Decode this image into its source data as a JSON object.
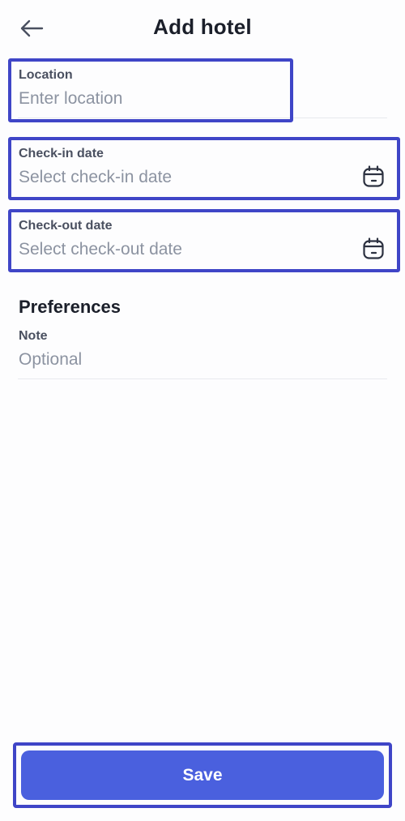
{
  "header": {
    "title": "Add hotel",
    "back_icon": "arrow-left-icon"
  },
  "form": {
    "location": {
      "label": "Location",
      "placeholder": "Enter location",
      "value": ""
    },
    "check_in": {
      "label": "Check-in date",
      "placeholder": "Select check-in date",
      "value": "",
      "icon": "calendar-icon"
    },
    "check_out": {
      "label": "Check-out date",
      "placeholder": "Select check-out date",
      "value": "",
      "icon": "calendar-icon"
    }
  },
  "preferences": {
    "title": "Preferences",
    "note": {
      "label": "Note",
      "placeholder": "Optional",
      "value": ""
    }
  },
  "footer": {
    "save_label": "Save"
  },
  "colors": {
    "accent": "#4a60de",
    "highlight": "#3f45c7",
    "placeholder": "#8c93a1",
    "label": "#4a5060"
  }
}
